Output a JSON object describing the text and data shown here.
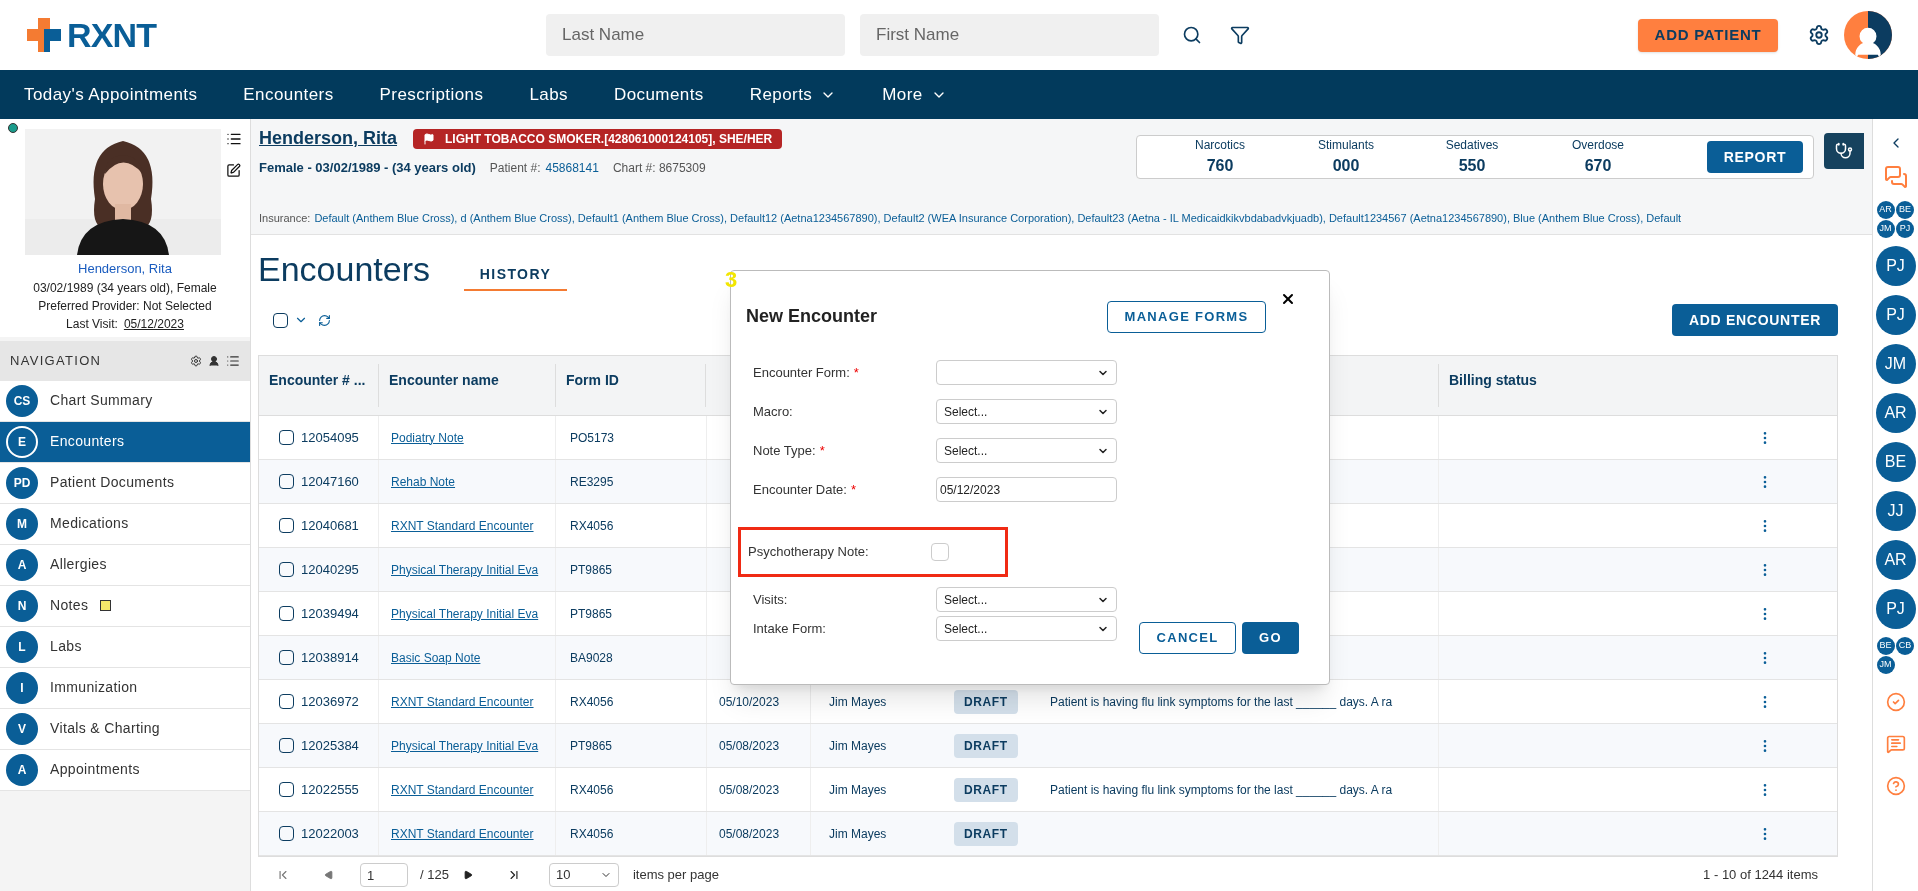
{
  "header": {
    "logo": "RXNT",
    "search_fields": [
      {
        "placeholder": "Last Name"
      },
      {
        "placeholder": "First Name"
      }
    ],
    "add_patient": "ADD PATIENT"
  },
  "nav": [
    {
      "label": "Today's Appointments",
      "dropdown": false
    },
    {
      "label": "Encounters",
      "dropdown": false
    },
    {
      "label": "Prescriptions",
      "dropdown": false
    },
    {
      "label": "Labs",
      "dropdown": false
    },
    {
      "label": "Documents",
      "dropdown": false
    },
    {
      "label": "Reports",
      "dropdown": true
    },
    {
      "label": "More",
      "dropdown": true
    }
  ],
  "patient_card": {
    "online": true,
    "name": "Henderson, Rita",
    "details": [
      "03/02/1989 (34 years old), Female",
      "Preferred Provider: Not Selected"
    ],
    "last_visit_label": "Last Visit:",
    "last_visit": "05/12/2023"
  },
  "sidebar": {
    "title": "NAVIGATION",
    "items": [
      {
        "initials": "CS",
        "label": "Chart Summary",
        "selected": false,
        "has_note": false
      },
      {
        "initials": "E",
        "label": "Encounters",
        "selected": true,
        "has_note": false
      },
      {
        "initials": "PD",
        "label": "Patient Documents",
        "selected": false,
        "has_note": false
      },
      {
        "initials": "M",
        "label": "Medications",
        "selected": false,
        "has_note": false
      },
      {
        "initials": "A",
        "label": "Allergies",
        "selected": false,
        "has_note": false
      },
      {
        "initials": "N",
        "label": "Notes",
        "selected": false,
        "has_note": true
      },
      {
        "initials": "L",
        "label": "Labs",
        "selected": false,
        "has_note": false
      },
      {
        "initials": "I",
        "label": "Immunization",
        "selected": false,
        "has_note": false
      },
      {
        "initials": "V",
        "label": "Vitals & Charting",
        "selected": false,
        "has_note": false
      },
      {
        "initials": "A",
        "label": "Appointments",
        "selected": false,
        "has_note": false
      }
    ]
  },
  "patient_header": {
    "name": "Henderson, Rita",
    "flag": "LIGHT TOBACCO SMOKER.[428061000124105], SHE/HER",
    "summary": "Female - 03/02/1989 - (34 years old)",
    "patient_label": "Patient #:",
    "patient_number": "45868141",
    "chart": "Chart #: 8675309",
    "insurance_label": "Insurance:",
    "insurance": "Default (Anthem Blue Cross), d (Anthem Blue Cross), Default1 (Anthem Blue Cross), Default12 (Aetna1234567890), Default2 (WEA Insurance Corporation), Default23 (Aetna - IL Medicaidkikvbdabadvkjuadb), Default1234567 (Aetna1234567890), Blue (Anthem Blue Cross), Default",
    "counters": [
      {
        "label": "Narcotics",
        "value": "760"
      },
      {
        "label": "Stimulants",
        "value": "000"
      },
      {
        "label": "Sedatives",
        "value": "550"
      },
      {
        "label": "Overdose",
        "value": "670"
      }
    ],
    "report": "REPORT"
  },
  "page": {
    "title": "Encounters",
    "tabs": [
      {
        "label": "HISTORY",
        "selected": true
      }
    ],
    "select_all": {
      "checked": false
    },
    "add_button": "ADD ENCOUNTER"
  },
  "table": {
    "columns": {
      "number": "Encounter # ...",
      "name": "Encounter name",
      "form_id": "Form ID",
      "billing": "Billing status"
    },
    "rows": [
      {
        "checked": false,
        "number": "12054095",
        "name": "Podiatry Note",
        "form_id": "PO5173"
      },
      {
        "checked": false,
        "number": "12047160",
        "name": "Rehab Note",
        "form_id": "RE3295"
      },
      {
        "checked": false,
        "number": "12040681",
        "name": "RXNT Standard Encounter",
        "form_id": "RX4056"
      },
      {
        "checked": false,
        "number": "12040295",
        "name": "Physical Therapy Initial Eva",
        "form_id": "PT9865"
      },
      {
        "checked": false,
        "number": "12039494",
        "name": "Physical Therapy Initial Eva",
        "form_id": "PT9865"
      },
      {
        "checked": false,
        "number": "12038914",
        "name": "Basic Soap Note",
        "form_id": "BA9028"
      },
      {
        "checked": false,
        "number": "12036972",
        "name": "RXNT Standard Encounter",
        "form_id": "RX4056",
        "date": "05/10/2023",
        "provider": "Jim Mayes",
        "status": "DRAFT",
        "notes": "Patient is having flu link symptoms for the last ______ days. A ra"
      },
      {
        "checked": false,
        "number": "12025384",
        "name": "Physical Therapy Initial Eva",
        "form_id": "PT9865",
        "date": "05/08/2023",
        "provider": "Jim Mayes",
        "status": "DRAFT"
      },
      {
        "checked": false,
        "number": "12022555",
        "name": "RXNT Standard Encounter",
        "form_id": "RX4056",
        "date": "05/08/2023",
        "provider": "Jim Mayes",
        "status": "DRAFT",
        "notes": "Patient is having flu link symptoms for the last ______ days. A ra"
      },
      {
        "checked": false,
        "number": "12022003",
        "name": "RXNT Standard Encounter",
        "form_id": "RX4056",
        "date": "05/08/2023",
        "provider": "Jim Mayes",
        "status": "DRAFT"
      }
    ],
    "pager": {
      "page": "1",
      "total": "/ 125",
      "per_page": "10",
      "per_page_label": "items per page",
      "range": "1 - 10 of 1244 items"
    }
  },
  "modal": {
    "annotation": "3",
    "title": "New Encounter",
    "manage_button": "MANAGE FORMS",
    "required_mark": "*",
    "fields": [
      {
        "kind": "select",
        "label": "Encounter Form:",
        "required": true,
        "highlighted": false
      },
      {
        "kind": "select",
        "label": "Macro:",
        "required": false,
        "value": "Select...",
        "highlighted": false
      },
      {
        "kind": "select",
        "label": "Note Type:",
        "required": true,
        "value": "Select...",
        "highlighted": false
      },
      {
        "kind": "date",
        "label": "Encounter Date:",
        "required": true,
        "value": "05/12/2023",
        "highlighted": false
      },
      {
        "kind": "checkbox",
        "label": "Psychotherapy Note:",
        "required": false,
        "checked": false,
        "highlighted": true
      },
      {
        "kind": "select",
        "label": "Visits:",
        "required": false,
        "value": "Select...",
        "highlighted": false
      },
      {
        "kind": "select",
        "label": "Intake Form:",
        "required": false,
        "value": "Select...",
        "highlighted": false
      }
    ],
    "cancel": "CANCEL",
    "go": "GO"
  },
  "right_rail": {
    "top_group": [
      "AR",
      "BE",
      "JM",
      "PJ"
    ],
    "avatars": [
      "PJ",
      "PJ",
      "JM",
      "AR",
      "BE",
      "JJ",
      "AR",
      "PJ"
    ],
    "bottom_group": [
      "BE",
      "CB",
      "JM"
    ]
  }
}
